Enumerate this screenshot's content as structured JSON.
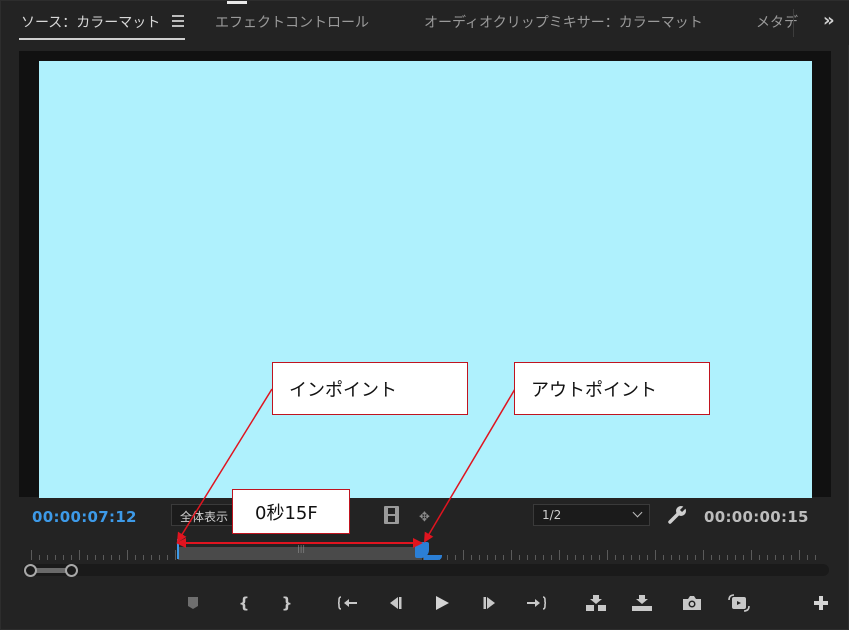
{
  "tabs": [
    {
      "label": "ソース：カラーマット",
      "active": true
    },
    {
      "label": "エフェクトコントロール",
      "active": false
    },
    {
      "label": "オーディオクリップミキサー：カラーマット",
      "active": false
    },
    {
      "label": "メタデ",
      "active": false
    }
  ],
  "overflow_label": "»",
  "monitor": {
    "frame_color": "#aff1fd",
    "timecode_current": "00:00:07:12",
    "timecode_duration": "00:00:00:15",
    "zoom_value": "全体表示",
    "quality_value": "1/2"
  },
  "annotations": {
    "in_point": "インポイント",
    "out_point": "アウトポイント",
    "duration": "0秒15F"
  },
  "transport_icons": [
    "add-marker-icon",
    "mark-in-icon",
    "mark-out-icon",
    "go-to-in-icon",
    "step-back-icon",
    "play-icon",
    "step-forward-icon",
    "go-to-out-icon",
    "insert-icon",
    "overwrite-icon",
    "export-frame-icon",
    "toggle-proxies-icon",
    "button-editor-icon"
  ],
  "colors": {
    "accent_blue": "#3d9ae8",
    "annotation_red": "#c0141f"
  }
}
